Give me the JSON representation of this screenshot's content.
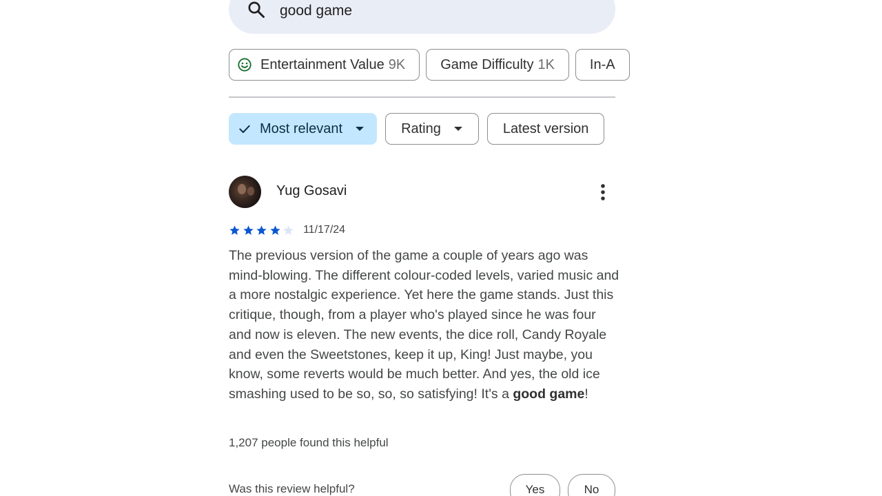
{
  "search": {
    "query": "good game",
    "icon": "search-icon"
  },
  "topics": [
    {
      "label": "Entertainment Value",
      "count": "9K",
      "icon": "smiley-icon"
    },
    {
      "label": "Game Difficulty",
      "count": "1K"
    },
    {
      "label": "In-A",
      "count": ""
    }
  ],
  "filters": {
    "sort": {
      "label": "Most relevant",
      "selected": true
    },
    "rating": {
      "label": "Rating"
    },
    "version": {
      "label": "Latest version"
    }
  },
  "review": {
    "author": "Yug Gosavi",
    "rating": 4,
    "max_rating": 5,
    "date": "11/17/24",
    "text_before": "The previous version of the game a couple of years ago was mind-blowing. The different colour-coded levels, varied music and a more nostalgic experience. Yet here the game stands. Just this critique, though, from a player who's played since he was four and now is eleven. The new events, the dice roll, Candy Royale and even the Sweetstones, keep it up, King! Just maybe, you know, some reverts would be much better. And yes, the old ice smashing used to be so, so, so satisfying! It's a ",
    "text_highlight": "good game",
    "text_after": "!",
    "helpful_count": "1,207 people found this helpful",
    "helpful_prompt": "Was this review helpful?",
    "yes_label": "Yes",
    "no_label": "No"
  },
  "colors": {
    "accent_star": "#0b57d0",
    "empty_star": "#dbe5f7",
    "selected_chip_bg": "#c3e7fe",
    "search_bg": "#e9edf6",
    "smiley": "#146c2e"
  }
}
